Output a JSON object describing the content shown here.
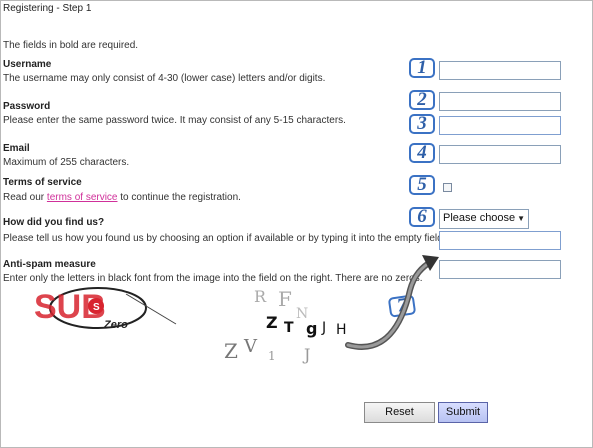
{
  "window": {
    "title": "Registering - Step 1"
  },
  "form": {
    "required_note": "The fields in bold are required.",
    "username": {
      "label": "Username",
      "help": "The username may only consist of 4-30 (lower case) letters and/or digits.",
      "value": ""
    },
    "password": {
      "label": "Password",
      "help": "Please enter the same password twice. It may consist of any 5-15 characters.",
      "value": "",
      "confirm_value": ""
    },
    "email": {
      "label": "Email",
      "help": "Maximum of 255 characters.",
      "value": ""
    },
    "terms": {
      "label": "Terms of service",
      "help_prefix": "Read our ",
      "link_text": "terms of service",
      "help_suffix": " to continue the registration.",
      "checked": false
    },
    "find_us": {
      "label": "How did you find us?",
      "help": "Please tell us how you found us by choosing an option if available or by typing it into the empty field.",
      "selected": "Please choose",
      "value": ""
    },
    "antispam": {
      "label": "Anti-spam measure",
      "help": "Enter only the letters in black font from the image into the field on the right. There are no zeros.",
      "value": ""
    }
  },
  "annotations": {
    "badges": [
      "1",
      "2",
      "3",
      "4",
      "5",
      "6",
      "7"
    ],
    "color": "#2e5fa8"
  },
  "watermark": {
    "brand": "SUB",
    "tag": "Zero"
  },
  "captcha": {
    "letters": [
      "Z",
      "T",
      "g",
      "J",
      "H",
      "Z",
      "V"
    ]
  },
  "buttons": {
    "reset": "Reset",
    "submit": "Submit"
  },
  "colors": {
    "link": "#d0309a",
    "input_border": "#8aa0b8",
    "badge": "#3b72c4",
    "submit_bg": "#b7c2f2"
  }
}
